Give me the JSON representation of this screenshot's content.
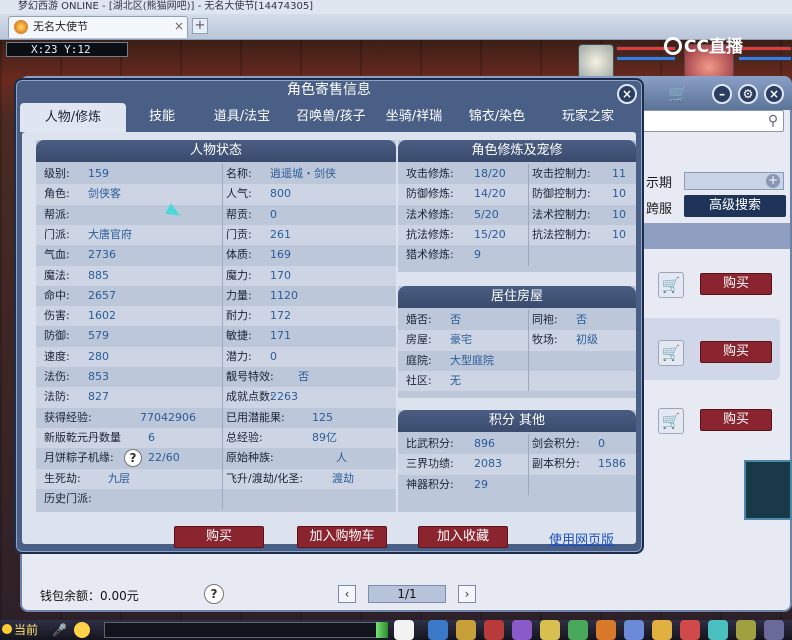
{
  "window": {
    "title": "梦幻西游 ONLINE - [湖北区(熊猫网吧)] - 无名大使节[14474305]"
  },
  "tab": {
    "label": "无名大使节"
  },
  "hud": {
    "coords": "X:23 Y:12",
    "logo": "CC直播"
  },
  "store": {
    "filter_label": "示期",
    "cross_label": "跨服",
    "advanced_search": "高级搜索",
    "buy_label": "购买",
    "wallet": "钱包余额：0.00元",
    "page": "1/1",
    "current_channel": "当前"
  },
  "popup": {
    "title": "角色寄售信息",
    "tabs": [
      "人物/修炼",
      "技能",
      "道具/法宝",
      "召唤兽/孩子",
      "坐骑/祥瑞",
      "锦衣/染色",
      "玩家之家"
    ],
    "status": {
      "title": "人物状态",
      "rows": [
        {
          "k1": "级别:",
          "v1": "159",
          "k2": "名称:",
          "v2": "逍遥城・剑侠"
        },
        {
          "k1": "角色:",
          "v1": "剑侠客",
          "k2": "人气:",
          "v2": "800"
        },
        {
          "k1": "帮派:",
          "v1": "",
          "k2": "帮贡:",
          "v2": "0"
        },
        {
          "k1": "门派:",
          "v1": "大唐官府",
          "k2": "门贡:",
          "v2": "261"
        },
        {
          "k1": "气血:",
          "v1": "2736",
          "k2": "体质:",
          "v2": "169"
        },
        {
          "k1": "魔法:",
          "v1": "885",
          "k2": "魔力:",
          "v2": "170"
        },
        {
          "k1": "命中:",
          "v1": "2657",
          "k2": "力量:",
          "v2": "1120"
        },
        {
          "k1": "伤害:",
          "v1": "1602",
          "k2": "耐力:",
          "v2": "172"
        },
        {
          "k1": "防御:",
          "v1": "579",
          "k2": "敏捷:",
          "v2": "171"
        },
        {
          "k1": "速度:",
          "v1": "280",
          "k2": "潜力:",
          "v2": "0"
        },
        {
          "k1": "法伤:",
          "v1": "853",
          "k2": "靓号特效:",
          "v2": "否"
        },
        {
          "k1": "法防:",
          "v1": "827",
          "k2": "成就点数:",
          "v2": "2263"
        },
        {
          "k1": "获得经验:",
          "v1": "77042906",
          "k2": "已用潜能果:",
          "v2": "125"
        },
        {
          "k1": "新版乾元丹数量",
          "v1": "6",
          "k2": "总经验:",
          "v2": "89亿"
        },
        {
          "k1": "月饼粽子机缘:",
          "v1": "22/60",
          "k2": "原始种族:",
          "v2": "人"
        },
        {
          "k1": "生死劫:",
          "v1": "九层",
          "k2": "飞升/渡劫/化圣:",
          "v2": "渡劫"
        },
        {
          "k1": "历史门派:",
          "v1": "",
          "k2": "",
          "v2": ""
        }
      ]
    },
    "cultivation": {
      "title": "角色修炼及宠修",
      "rows": [
        {
          "k1": "攻击修炼:",
          "v1": "18/20",
          "k2": "攻击控制力:",
          "v2": "11"
        },
        {
          "k1": "防御修炼:",
          "v1": "14/20",
          "k2": "防御控制力:",
          "v2": "10"
        },
        {
          "k1": "法术修炼:",
          "v1": "5/20",
          "k2": "法术控制力:",
          "v2": "10"
        },
        {
          "k1": "抗法修炼:",
          "v1": "15/20",
          "k2": "抗法控制力:",
          "v2": "10"
        },
        {
          "k1": "猎术修炼:",
          "v1": "9",
          "k2": "",
          "v2": ""
        }
      ]
    },
    "house": {
      "title": "居住房屋",
      "rows": [
        {
          "k1": "婚否:",
          "v1": "否",
          "k2": "同袍:",
          "v2": "否"
        },
        {
          "k1": "房屋:",
          "v1": "豪宅",
          "k2": "牧场:",
          "v2": "初级"
        },
        {
          "k1": "庭院:",
          "v1": "大型庭院",
          "k2": "",
          "v2": ""
        },
        {
          "k1": "社区:",
          "v1": "无",
          "k2": "",
          "v2": ""
        }
      ]
    },
    "points": {
      "title": "积分 其他",
      "rows": [
        {
          "k1": "比武积分:",
          "v1": "896",
          "k2": "剑会积分:",
          "v2": "0"
        },
        {
          "k1": "三界功绩:",
          "v1": "2083",
          "k2": "副本积分:",
          "v2": "1586"
        },
        {
          "k1": "神器积分:",
          "v1": "29",
          "k2": "",
          "v2": ""
        }
      ]
    },
    "buttons": {
      "buy": "购买",
      "add_cart": "加入购物车",
      "favorite": "加入收藏",
      "web": "使用网页版"
    }
  }
}
